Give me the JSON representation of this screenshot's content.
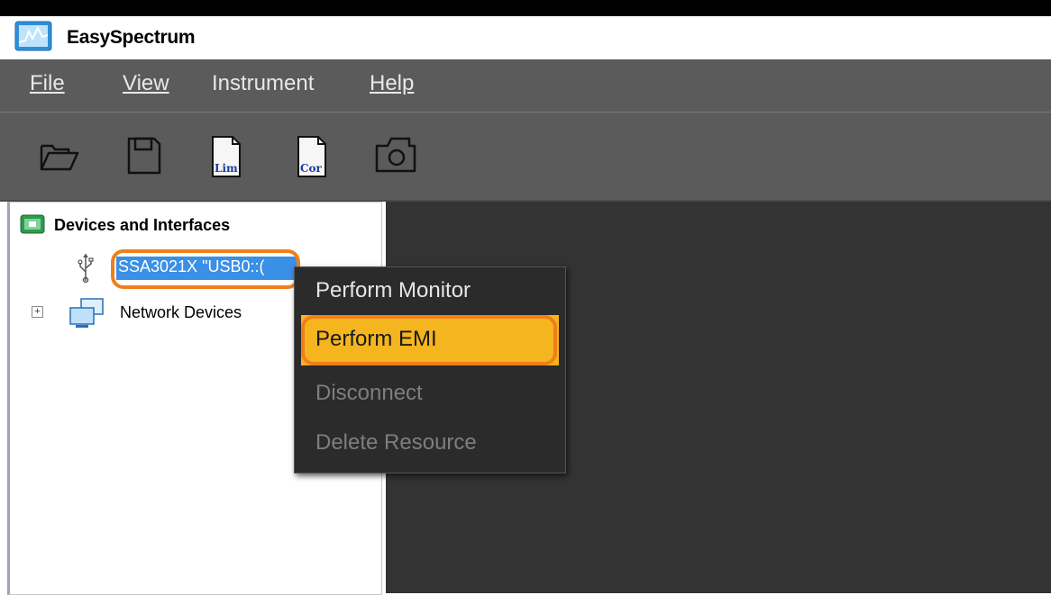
{
  "app": {
    "title": "EasySpectrum",
    "icon": "app-spectrum-icon"
  },
  "menu": [
    {
      "label": "File"
    },
    {
      "label": "View"
    },
    {
      "label": "Instrument"
    },
    {
      "label": "Help"
    }
  ],
  "toolbar": {
    "items": [
      {
        "icon": "open-folder-icon"
      },
      {
        "icon": "save-floppy-icon"
      },
      {
        "icon": "limit-file-icon",
        "text": "Lim"
      },
      {
        "icon": "correction-file-icon",
        "text": "Cor"
      },
      {
        "icon": "camera-icon"
      }
    ]
  },
  "tree": {
    "root_label": "Devices and Interfaces",
    "usb_device_label": "SSA3021X \"USB0::(",
    "network_label": "Network Devices",
    "expander": "+"
  },
  "context_menu": {
    "items": [
      {
        "label": "Perform Monitor",
        "enabled": true
      },
      {
        "label": "Perform EMI",
        "enabled": true,
        "highlighted": true
      },
      {
        "label": "Disconnect",
        "enabled": false
      },
      {
        "label": "Delete Resource",
        "enabled": false
      }
    ]
  },
  "colors": {
    "menubar_bg": "#5b5b5b",
    "main_bg": "#333333",
    "context_bg": "#2b2b2b",
    "highlight": "#f5b51e",
    "annotation_ring": "#f07f1a",
    "selection": "#3a8fe6"
  }
}
